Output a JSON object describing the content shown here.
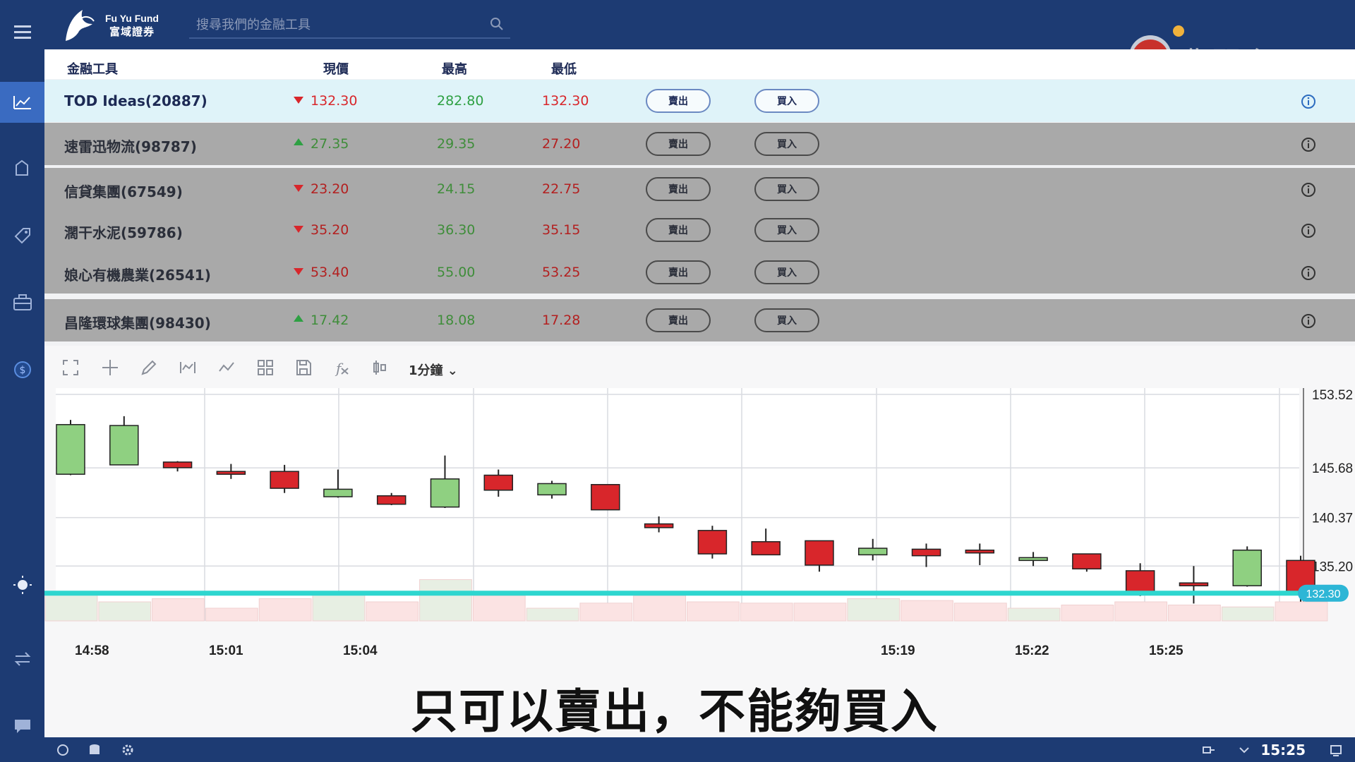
{
  "topbar": {
    "brand_en": "Fu Yu Fund",
    "brand_zh": "富域證券",
    "search_placeholder": "搜尋我們的金融工具"
  },
  "watermark": {
    "channel": "翡翠台"
  },
  "table": {
    "headers": {
      "instrument": "金融工具",
      "price": "現價",
      "high": "最高",
      "low": "最低"
    },
    "sell_label": "賣出",
    "buy_label": "買入",
    "rows": [
      {
        "name": "TOD Ideas(20887)",
        "dir": "down",
        "price": "132.30",
        "high": "282.80",
        "low": "132.30",
        "selected": true
      },
      {
        "name": "速雷迅物流(98787)",
        "dir": "up",
        "price": "27.35",
        "high": "29.35",
        "low": "27.20",
        "selected": false
      },
      {
        "name": "信貸集團(67549)",
        "dir": "down",
        "price": "23.20",
        "high": "24.15",
        "low": "22.75",
        "selected": false
      },
      {
        "name": "濶干水泥(59786)",
        "dir": "down",
        "price": "35.20",
        "high": "36.30",
        "low": "35.15",
        "selected": false
      },
      {
        "name": "娘心有機農業(26541)",
        "dir": "down",
        "price": "53.40",
        "high": "55.00",
        "low": "53.25",
        "selected": false
      },
      {
        "name": "昌隆環球集團(98430)",
        "dir": "up",
        "price": "17.42",
        "high": "18.08",
        "low": "17.28",
        "selected": false
      }
    ]
  },
  "toolbar": {
    "interval": "1分鐘"
  },
  "chart_data": {
    "type": "candlestick",
    "title": "",
    "y_ticks": [
      153.52,
      145.68,
      140.37,
      135.2
    ],
    "x_ticks": [
      "14:58",
      "15:01",
      "15:04",
      "15:19",
      "15:22",
      "15:25"
    ],
    "last_price": "132.30",
    "candles": [
      {
        "o": 145.0,
        "h": 150.8,
        "l": 144.9,
        "c": 150.3
      },
      {
        "o": 146.0,
        "h": 151.2,
        "l": 146.0,
        "c": 150.2
      },
      {
        "o": 146.3,
        "h": 146.4,
        "l": 145.3,
        "c": 145.7
      },
      {
        "o": 145.3,
        "h": 146.1,
        "l": 144.5,
        "c": 145.0
      },
      {
        "o": 145.3,
        "h": 146.0,
        "l": 143.0,
        "c": 143.5
      },
      {
        "o": 142.6,
        "h": 145.5,
        "l": 142.5,
        "c": 143.4
      },
      {
        "o": 142.7,
        "h": 143.0,
        "l": 141.7,
        "c": 141.8
      },
      {
        "o": 141.5,
        "h": 147.0,
        "l": 141.4,
        "c": 144.5
      },
      {
        "o": 144.9,
        "h": 145.5,
        "l": 142.6,
        "c": 143.3
      },
      {
        "o": 142.8,
        "h": 144.3,
        "l": 142.4,
        "c": 144.0
      },
      {
        "o": 143.9,
        "h": 143.9,
        "l": 141.2,
        "c": 141.2
      },
      {
        "o": 139.7,
        "h": 140.5,
        "l": 138.8,
        "c": 139.3
      },
      {
        "o": 139.0,
        "h": 139.5,
        "l": 136.0,
        "c": 136.5
      },
      {
        "o": 137.8,
        "h": 139.2,
        "l": 136.7,
        "c": 136.4
      },
      {
        "o": 137.9,
        "h": 137.9,
        "l": 134.6,
        "c": 135.3
      },
      {
        "o": 136.4,
        "h": 138.1,
        "l": 135.8,
        "c": 137.1
      },
      {
        "o": 137.0,
        "h": 137.6,
        "l": 135.1,
        "c": 136.3
      },
      {
        "o": 136.9,
        "h": 137.6,
        "l": 135.3,
        "c": 136.6
      },
      {
        "o": 135.9,
        "h": 136.7,
        "l": 135.2,
        "c": 136.1
      },
      {
        "o": 136.5,
        "h": 136.5,
        "l": 134.6,
        "c": 134.9
      },
      {
        "o": 134.7,
        "h": 135.5,
        "l": 132.0,
        "c": 132.3
      },
      {
        "o": 133.4,
        "h": 135.2,
        "l": 131.2,
        "c": 133.1
      },
      {
        "o": 133.1,
        "h": 137.3,
        "l": 133.0,
        "c": 136.9
      },
      {
        "o": 135.8,
        "h": 136.3,
        "l": 131.4,
        "c": 132.3
      }
    ],
    "volumes": [
      0.42,
      0.3,
      0.35,
      0.2,
      0.35,
      0.45,
      0.3,
      0.65,
      0.4,
      0.2,
      0.28,
      0.4,
      0.3,
      0.28,
      0.28,
      0.35,
      0.32,
      0.28,
      0.2,
      0.25,
      0.3,
      0.25,
      0.22,
      0.3
    ],
    "colors": {
      "up": "#8fd081",
      "down": "#d8262b",
      "price_line": "#2ed6cf"
    }
  },
  "subtitle": "只可以賣出，不能夠買入",
  "status": {
    "clock": "15:25"
  }
}
